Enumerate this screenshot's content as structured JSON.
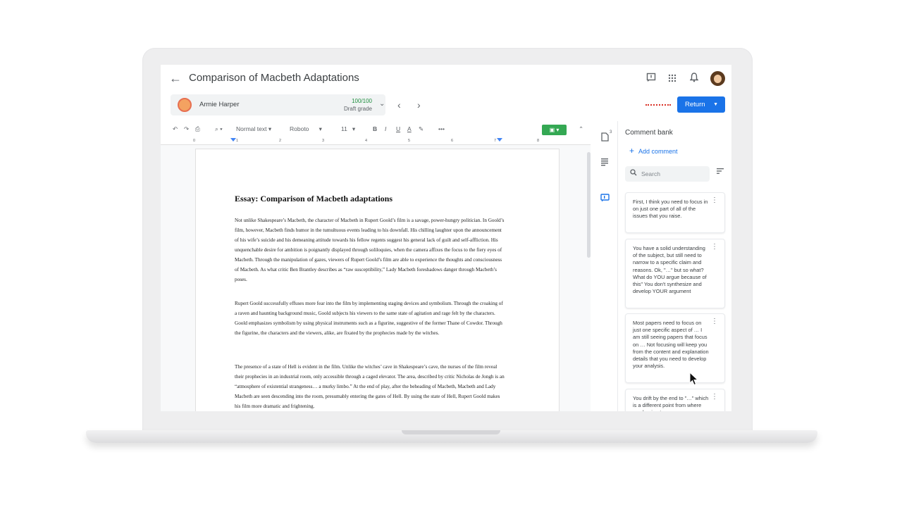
{
  "header": {
    "title": "Comparison of Macbeth Adaptations"
  },
  "student": {
    "name": "Armie Harper",
    "grade": "100/100",
    "grade_label": "Draft grade"
  },
  "actions": {
    "return_label": "Return"
  },
  "toolbar": {
    "style": "Normal text",
    "font": "Roboto",
    "size": "11",
    "bold": "B",
    "italic": "I",
    "underline": "U",
    "textcolor": "A",
    "more": "•••"
  },
  "ruler": [
    "0",
    "1",
    "2",
    "3",
    "4",
    "5",
    "6",
    "7",
    "8"
  ],
  "document": {
    "title": "Essay: Comparison of Macbeth adaptations",
    "paragraphs": [
      "Not unlike Shakespeare’s Macbeth, the character of Macbeth in Rupert Goold’s film is a savage, power-hungry politician. In Goold’s film, however, Macbeth finds humor in the tumultuous events leading to his downfall. His chilling laughter upon the announcement of his wife’s suicide and his demeaning attitude towards his fellow regents suggest his general lack of guilt and self-affliction. His unquenchable desire for ambition is poignantly displayed through soliloquies, when the camera affixes the focus to the fiery eyes of Macbeth. Through the manipulation of gazes, viewers of Rupert Goold’s film are able to experience the thoughts and consciousness of Macbeth. As what critic Ben Brantley describes as “raw susceptibility,” Lady Macbeth foreshadows danger through Macbeth’s poses.",
      "Rupert Goold successfully effuses more fear into the film by implementing staging devices and symbolism. Through the croaking of a raven and haunting background music, Goold subjects his viewers to the same state of agitation and rage felt by the characters. Goold emphasizes symbolism by using physical instruments such as a figurine, suggestive of the former Thane of Cowdor. Through the figurine, the characters and the viewers, alike, are fixated by the prophecies made by the witches.",
      "The presence of a state of Hell is evident in the film. Unlike the witches’ cave in Shakespeare’s cave, the nurses of the film reveal their prophecies in an industrial room, only accessible through a caged elevator. The area, described by critic Nicholas de Jongh is an “atmosphere of existential strangeness… a murky limbo.” At the end of play, after the beheading of Macbeth, Macbeth and Lady Macbeth are seen descending into the room, presumably entering the gates of Hell. By using the state of Hell, Rupert Goold makes his film more dramatic and frightening."
    ]
  },
  "side_badge": "3",
  "comment_bank": {
    "title": "Comment bank",
    "add_label": "Add comment",
    "search_placeholder": "Search",
    "comments": [
      "First, I think you need to focus in on just one part of all of the issues that you raise.",
      "You have a solid understanding of the subject, but still need to narrow to a specific claim and reasons. Ok, \"…\" but so what? What do YOU argue because of this\" You don't synthesize and develop YOUR argument",
      "Most papers need to focus on just one specific aspect of … I am still seeing papers that focus on … Not focusing will keep you from the content and explanation details that you need to develop your analysis.",
      "You drift by the end to \"…\" which is a different point from where you begin at"
    ]
  },
  "colors": {
    "accent": "#1a73e8",
    "grade": "#1e8e3e",
    "green": "#34a853"
  }
}
